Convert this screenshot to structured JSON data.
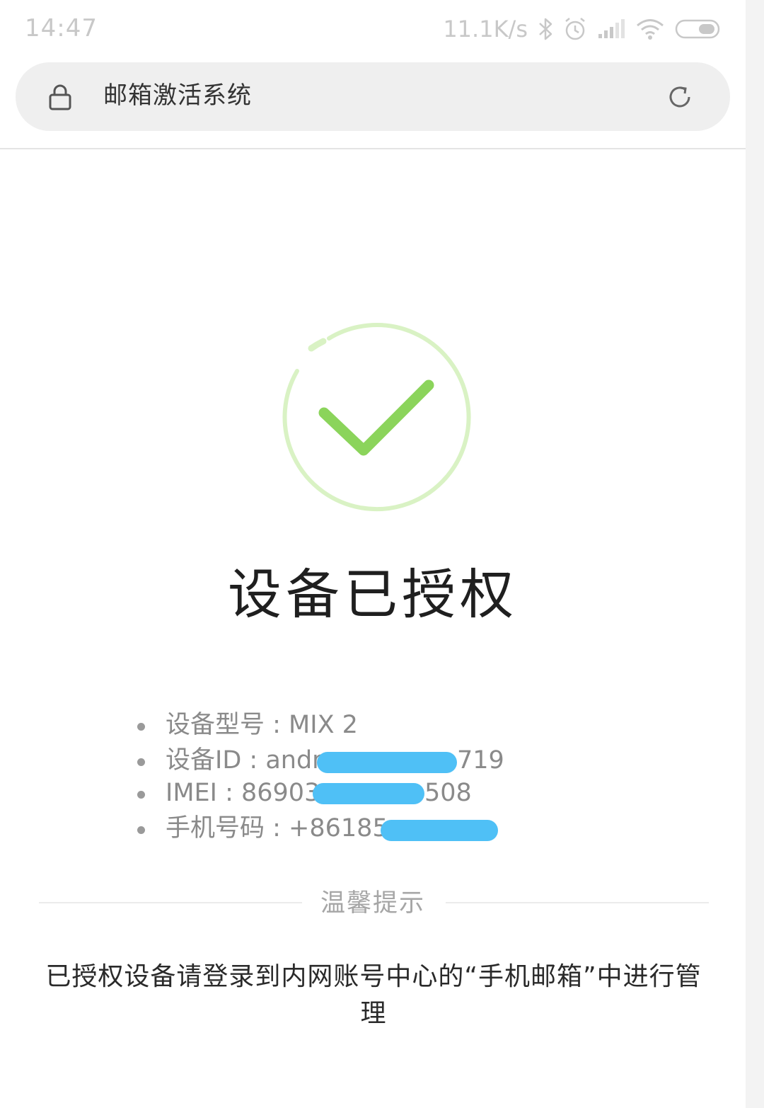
{
  "status_bar": {
    "time": "14:47",
    "net_speed": "11.1K/s",
    "icons": [
      "bluetooth-icon",
      "alarm-icon",
      "signal-icon",
      "wifi-icon",
      "battery-icon"
    ]
  },
  "address_bar": {
    "lock_icon": "lock-icon",
    "title": "邮箱激活系统",
    "reload_icon": "reload-icon"
  },
  "result": {
    "icon": "success-check-icon",
    "title": "设备已授权",
    "colors": {
      "check": "#8bd45b",
      "ring": "#d9f2c4"
    }
  },
  "device_info": [
    {
      "label": "设备型号 : MIX 2"
    },
    {
      "label": "设备ID : andr",
      "suffix": "719"
    },
    {
      "label": "IMEI : 86903",
      "suffix": "508"
    },
    {
      "label": "手机号码 : +86185"
    }
  ],
  "tips": {
    "label": "温馨提示",
    "body": "已授权设备请登录到内网账号中心的“手机邮箱”中进行管理"
  },
  "colors": {
    "redaction": "#4fc0f6"
  }
}
